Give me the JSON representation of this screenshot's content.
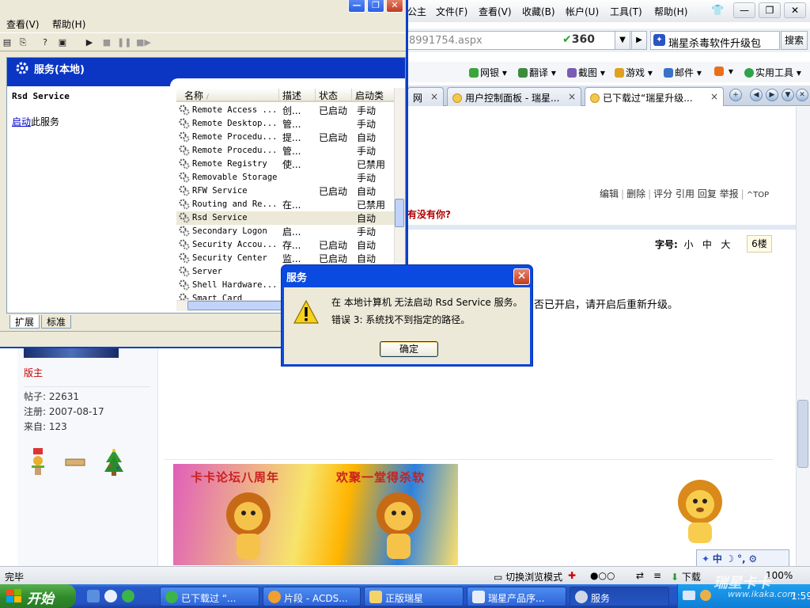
{
  "browser": {
    "menus": [
      "公主",
      "文件(F)",
      "查看(V)",
      "收藏(B)",
      "帐户(U)",
      "工具(T)",
      "帮助(H)"
    ],
    "address": "8991754.aspx",
    "brand_360": "360",
    "search_text": "瑞星杀毒软件升级包",
    "search_button": "搜索",
    "tools": [
      "网银",
      "翻译",
      "截图",
      "游戏",
      "邮件",
      "实用工具"
    ],
    "tabs": [
      "网",
      "用户控制面板 - 瑞星...",
      "已下载过“瑞星升级..."
    ],
    "tab_close": "×",
    "win_minimize": "—",
    "win_maximize": "❐",
    "win_close": "✕",
    "dropdown_arrow": "▼",
    "go_arrow": "▶"
  },
  "page": {
    "post_actions": [
      "编辑",
      "删除",
      "评分",
      "引用",
      "回复",
      "举报"
    ],
    "top_label": "TOP",
    "thread_title": "有没有你?",
    "font_size_label": "字号:",
    "font_sizes": [
      "小",
      "中",
      "大"
    ],
    "floor": "6楼",
    "post_text": "否已开启，请开启后重新升级。",
    "user": {
      "role": "版主",
      "posts": "帖子: 22631",
      "registered": "注册:  2007-08-17",
      "from": "来自: 123"
    },
    "banner_left": "卡卡论坛八周年",
    "banner_right": "欢聚一堂得杀软"
  },
  "statusbar": {
    "text": "完毕",
    "mode_toggle": "切换浏览模式",
    "download": "下载",
    "zoom": "100%",
    "ime": "中 ☽ °,"
  },
  "services_window": {
    "menus": [
      "查看(V)",
      "帮助(H)"
    ],
    "header": "服务(本地)",
    "selected_service": "Rsd Service",
    "start_link": "启动",
    "start_suffix": "此服务",
    "columns": [
      "名称",
      "描述",
      "状态",
      "启动类"
    ],
    "rows": [
      {
        "name": "Remote Access ...",
        "desc": "创...",
        "status": "已启动",
        "startup": "手动"
      },
      {
        "name": "Remote Desktop...",
        "desc": "管...",
        "status": "",
        "startup": "手动"
      },
      {
        "name": "Remote Procedu...",
        "desc": "提...",
        "status": "已启动",
        "startup": "自动"
      },
      {
        "name": "Remote Procedu...",
        "desc": "管...",
        "status": "",
        "startup": "手动"
      },
      {
        "name": "Remote Registry",
        "desc": "使...",
        "status": "",
        "startup": "已禁用"
      },
      {
        "name": "Removable Storage",
        "desc": "",
        "status": "",
        "startup": "手动"
      },
      {
        "name": "RFW Service",
        "desc": "",
        "status": "已启动",
        "startup": "自动"
      },
      {
        "name": "Routing and Re...",
        "desc": "在...",
        "status": "",
        "startup": "已禁用"
      },
      {
        "name": "Rsd Service",
        "desc": "",
        "status": "",
        "startup": "自动"
      },
      {
        "name": "Secondary Logon",
        "desc": "启...",
        "status": "",
        "startup": "手动"
      },
      {
        "name": "Security Accou...",
        "desc": "存...",
        "status": "已启动",
        "startup": "自动"
      },
      {
        "name": "Security Center",
        "desc": "监...",
        "status": "已启动",
        "startup": "自动"
      },
      {
        "name": "Server",
        "desc": "",
        "status": "",
        "startup": ""
      },
      {
        "name": "Shell Hardware...",
        "desc": "",
        "status": "",
        "startup": ""
      },
      {
        "name": "Smart Card",
        "desc": "",
        "status": "",
        "startup": ""
      }
    ],
    "tabs": [
      "扩展",
      "标准"
    ]
  },
  "dialog": {
    "title": "服务",
    "line1": "在 本地计算机 无法启动 Rsd Service 服务。",
    "line2": "错误 3: 系统找不到指定的路径。",
    "ok": "确定",
    "close": "✕"
  },
  "taskbar": {
    "start": "开始",
    "buttons": [
      "已下载过 “...",
      "片段 - ACDS...",
      "正版瑞星",
      "瑞星产品序...",
      "服务"
    ],
    "clock": "1:59",
    "watermark": "瑞星卡卡",
    "watermark_url": "www.ikaka.com"
  },
  "colors": {
    "xp_blue": "#0a4ae0",
    "mmc_header": "#0b36c4",
    "thread_red": "#b00000",
    "taskbar_blue": "#2454c4",
    "start_green": "#2f8a2a"
  }
}
